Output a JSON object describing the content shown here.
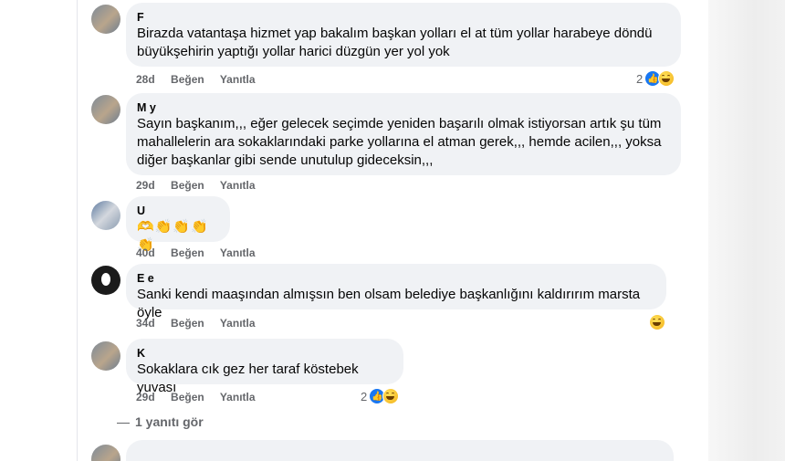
{
  "comments": [
    {
      "author": "F",
      "text": "Birazda vatantaşa hizmet yap bakalım başkan yolları el at tüm yollar harabeye döndü büyükşehirin yaptığı yollar harici düzgün yer yol yok",
      "age": "28d",
      "like": "Beğen",
      "reply": "Yanıtla",
      "reactions": {
        "count": "2",
        "icons": [
          "like-icon",
          "haha-icon"
        ]
      }
    },
    {
      "author": "M          y",
      "text": "Sayın başkanım,,, eğer gelecek seçimde yeniden başarılı olmak istiyorsan artık şu tüm mahallelerin ara sokaklarındaki parke yollarına el atman gerek,,, hemde acilen,,, yoksa diğer başkanlar gibi sende unutulup gideceksin,,,",
      "age": "29d",
      "like": "Beğen",
      "reply": "Yanıtla"
    },
    {
      "author": "U",
      "text": "🫶👏👏👏👏",
      "age": "40d",
      "like": "Beğen",
      "reply": "Yanıtla"
    },
    {
      "author": "E                  e",
      "text": "Sanki kendi maaşından almışsın ben olsam belediye başkanlığını kaldırırım marsta öyle",
      "age": "34d",
      "like": "Beğen",
      "reply": "Yanıtla",
      "reactions": {
        "count": "",
        "icons": [
          "haha-icon"
        ]
      }
    },
    {
      "author": "K",
      "text": "Sokaklara cık gez her taraf köstebek yuvası",
      "age": "29d",
      "like": "Beğen",
      "reply": "Yanıtla",
      "reactions": {
        "count": "2",
        "icons": [
          "like-icon",
          "haha-icon"
        ]
      }
    }
  ],
  "view_replies": "1 yanıtı gör",
  "colors": {
    "bubble": "#f0f2f5",
    "meta": "#65676b",
    "like_blue": "#1877f2",
    "haha_yellow": "#f7c12b"
  }
}
